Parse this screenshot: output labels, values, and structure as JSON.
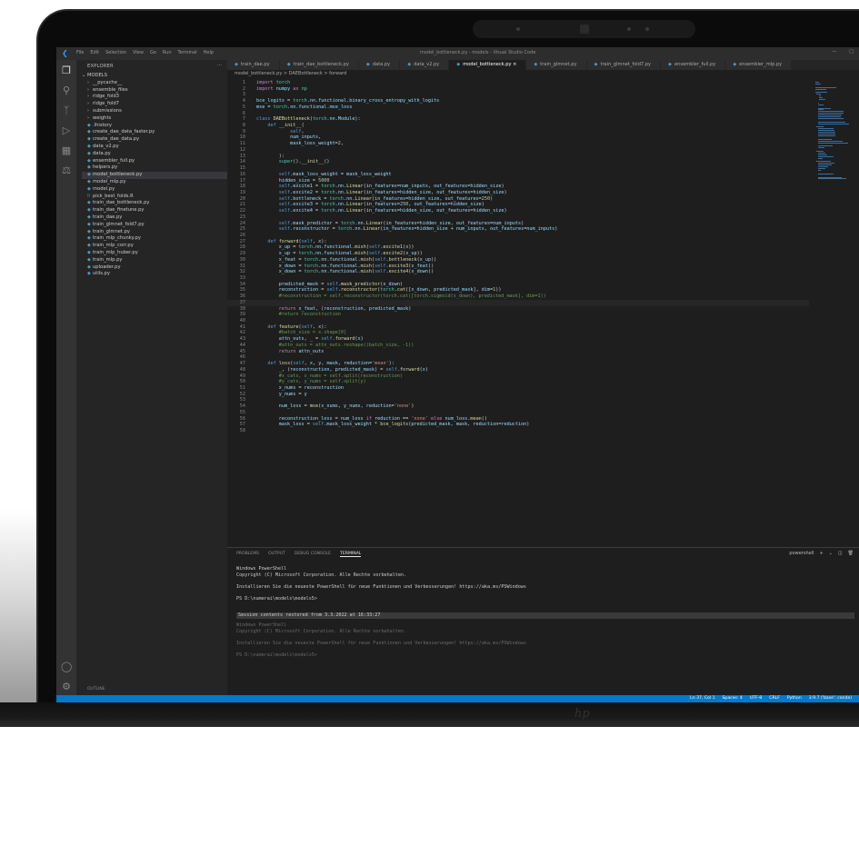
{
  "window": {
    "title": "model_bottleneck.py - models - Visual Studio Code",
    "menu": [
      "File",
      "Edit",
      "Selection",
      "View",
      "Go",
      "Run",
      "Terminal",
      "Help"
    ]
  },
  "sidebar": {
    "header": "EXPLORER",
    "root": "MODELS",
    "items": [
      "__pycache__",
      "ensemble_files",
      "ridge_fold3",
      "ridge_fold7",
      "submissions",
      "weights",
      ".lhistory",
      "create_dae_data_faster.py",
      "create_dae_data.py",
      "data_v2.py",
      "data.py",
      "ensembler_full.py",
      "helpers.py",
      "model_bottleneck.py",
      "model_mlp.py",
      "model.py",
      "pick_best_folds.R",
      "train_dae_bottleneck.py",
      "train_dae_finetune.py",
      "train_dae.py",
      "train_glmnet_fold7.py",
      "train_glmnet.py",
      "train_mlp_chunky.py",
      "train_mlp_corr.py",
      "train_mlp_huber.py",
      "train_mlp.py",
      "uploader.py",
      "utils.py"
    ],
    "selected_index": 13,
    "outline_label": "OUTLINE"
  },
  "tabs": [
    "train_dae.py",
    "train_dae_bottleneck.py",
    "data.py",
    "data_v2.py",
    "model_bottleneck.py",
    "train_glmnet.py",
    "train_glmnet_fold7.py",
    "ensembler_full.py",
    "ensembler_mlp.py"
  ],
  "active_tab": 4,
  "breadcrumb": "model_bottleneck.py > DAEBottleneck > forward",
  "code": [
    {
      "n": "1",
      "t": "import torch"
    },
    {
      "n": "2",
      "t": "import numpy as np"
    },
    {
      "n": "3",
      "t": ""
    },
    {
      "n": "4",
      "t": "bce_logits = torch.nn.functional.binary_cross_entropy_with_logits"
    },
    {
      "n": "5",
      "t": "mse = torch.nn.functional.mse_loss"
    },
    {
      "n": "6",
      "t": ""
    },
    {
      "n": "7",
      "t": "class DAEBottleneck(torch.nn.Module):"
    },
    {
      "n": "8",
      "t": "    def __init__("
    },
    {
      "n": "9",
      "t": "            self,"
    },
    {
      "n": "10",
      "t": "            num_inputs,"
    },
    {
      "n": "11",
      "t": "            mask_loss_weight=2,"
    },
    {
      "n": "12",
      "t": ""
    },
    {
      "n": "13",
      "t": "        ):"
    },
    {
      "n": "14",
      "t": "        super().__init__()"
    },
    {
      "n": "15",
      "t": ""
    },
    {
      "n": "16",
      "t": "        self.mask_loss_weight = mask_loss_weight"
    },
    {
      "n": "17",
      "t": "        hidden_size = 5000"
    },
    {
      "n": "18",
      "t": "        self.excite1 = torch.nn.Linear(in_features=num_inputs, out_features=hidden_size)"
    },
    {
      "n": "19",
      "t": "        self.excite2 = torch.nn.Linear(in_features=hidden_size, out_features=hidden_size)"
    },
    {
      "n": "20",
      "t": "        self.bottleneck = torch.nn.Linear(in_features=hidden_size, out_features=250)"
    },
    {
      "n": "21",
      "t": "        self.excite3 = torch.nn.Linear(in_features=250, out_features=hidden_size)"
    },
    {
      "n": "22",
      "t": "        self.excite4 = torch.nn.Linear(in_features=hidden_size, out_features=hidden_size)"
    },
    {
      "n": "23",
      "t": ""
    },
    {
      "n": "24",
      "t": "        self.mask_predictor = torch.nn.Linear(in_features=hidden_size, out_features=num_inputs)"
    },
    {
      "n": "25",
      "t": "        self.reconstructor = torch.nn.Linear(in_features=hidden_size + num_inputs, out_features=num_inputs)"
    },
    {
      "n": "26",
      "t": ""
    },
    {
      "n": "27",
      "t": "    def forward(self, x):"
    },
    {
      "n": "28",
      "t": "        x_up = torch.nn.functional.mish(self.excite1(x))"
    },
    {
      "n": "29",
      "t": "        x_up = torch.nn.functional.mish(self.excite2(x_up))"
    },
    {
      "n": "30",
      "t": "        x_feat = torch.nn.functional.mish(self.bottleneck(x_up))"
    },
    {
      "n": "31",
      "t": "        x_down = torch.nn.functional.mish(self.excite3(x_feat))"
    },
    {
      "n": "32",
      "t": "        x_down = torch.nn.functional.mish(self.excite4(x_down))"
    },
    {
      "n": "33",
      "t": ""
    },
    {
      "n": "34",
      "t": "        predicted_mask = self.mask_predictor(x_down)"
    },
    {
      "n": "35",
      "t": "        reconstruction = self.reconstructor(torch.cat([x_down, predicted_mask], dim=1))"
    },
    {
      "n": "36",
      "t": "        #reconstruction = self.reconstructor(torch.cat([torch.sigmoid(x_down), predicted_mask], dim=1))"
    },
    {
      "n": "37",
      "t": ""
    },
    {
      "n": "38",
      "t": "        return x_feat, (reconstruction, predicted_mask)"
    },
    {
      "n": "39",
      "t": "        #return reconstruction"
    },
    {
      "n": "40",
      "t": ""
    },
    {
      "n": "41",
      "t": "    def feature(self, x):"
    },
    {
      "n": "42",
      "t": "        #batch_size = x.shape[0]"
    },
    {
      "n": "43",
      "t": "        attn_outs, _ = self.forward(x)"
    },
    {
      "n": "44",
      "t": "        #attn_outs = attn_outs.reshape((batch_size, -1))"
    },
    {
      "n": "45",
      "t": "        return attn_outs"
    },
    {
      "n": "46",
      "t": ""
    },
    {
      "n": "47",
      "t": "    def loss(self, x, y, mask, reduction='mean'):"
    },
    {
      "n": "48",
      "t": "        _, (reconstruction, predicted_mask) = self.forward(x)"
    },
    {
      "n": "49",
      "t": "        #x_cats, x_nums = self.split(reconstruction)"
    },
    {
      "n": "50",
      "t": "        #y_cats, y_nums = self.split(y)"
    },
    {
      "n": "51",
      "t": "        x_nums = reconstruction"
    },
    {
      "n": "52",
      "t": "        y_nums = y"
    },
    {
      "n": "53",
      "t": ""
    },
    {
      "n": "54",
      "t": "        num_loss = mse(x_nums, y_nums, reduction='none')"
    },
    {
      "n": "55",
      "t": ""
    },
    {
      "n": "56",
      "t": "        reconstruction_loss = num_loss if reduction == 'none' else num_loss.mean()"
    },
    {
      "n": "57",
      "t": "        mask_loss = self.mask_loss_weight * bce_logits(predicted_mask, mask, reduction=reduction)"
    },
    {
      "n": "58",
      "t": ""
    }
  ],
  "current_line_index": 36,
  "panel": {
    "tabs": [
      "PROBLEMS",
      "OUTPUT",
      "DEBUG CONSOLE",
      "TERMINAL"
    ],
    "active_tab": 3,
    "shell": "powershell",
    "lines": [
      "Windows PowerShell",
      "Copyright (C) Microsoft Corporation. Alle Rechte vorbehalten.",
      "",
      "Installieren Sie die neueste PowerShell für neue Funktionen und Verbesserungen! https://aka.ms/PSWindows",
      "",
      "PS D:\\numerai\\models\\models5>",
      ""
    ],
    "session_notice": "Session contents restored from 3.3.2022 at 16:33:27",
    "restored_lines": [
      "Windows PowerShell",
      "Copyright (C) Microsoft Corporation. Alle Rechte vorbehalten.",
      "",
      "Installieren Sie die neueste PowerShell für neue Funktionen und Verbesserungen! https://aka.ms/PSWindows",
      "",
      "PS D:\\numerai\\models\\models5>"
    ]
  },
  "statusbar": {
    "right": [
      "Ln 37, Col 1",
      "Spaces: 4",
      "UTF-8",
      "CRLF",
      "Python",
      "3.9.7 ('base': conda)"
    ]
  },
  "colors": {
    "accent": "#007acc",
    "keyword": "#569cd6",
    "control": "#c586c0",
    "function": "#dcdcaa",
    "class": "#4ec9b0",
    "string": "#ce9178",
    "number": "#b5cea8",
    "comment": "#6a9955",
    "variable": "#9cdcfe"
  }
}
